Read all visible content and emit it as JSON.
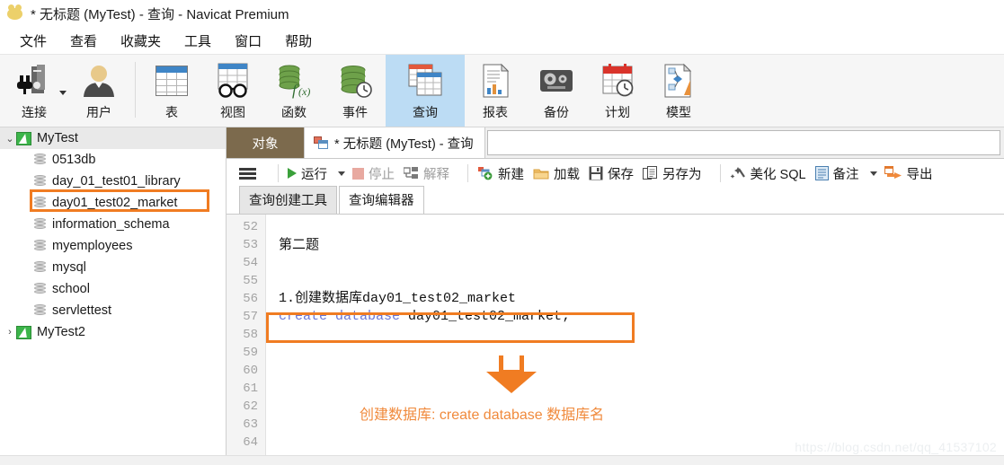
{
  "window": {
    "title": "* 无标题 (MyTest) - 查询 - Navicat Premium",
    "logo_icon": "navicat-logo-icon"
  },
  "menu": {
    "items": [
      {
        "label": "文件",
        "name": "menu-file"
      },
      {
        "label": "查看",
        "name": "menu-view"
      },
      {
        "label": "收藏夹",
        "name": "menu-favorites"
      },
      {
        "label": "工具",
        "name": "menu-tools"
      },
      {
        "label": "窗口",
        "name": "menu-window"
      },
      {
        "label": "帮助",
        "name": "menu-help"
      }
    ]
  },
  "ribbon": {
    "buttons": [
      {
        "label": "连接",
        "icon": "connection-icon",
        "active": false,
        "dropdown": true
      },
      {
        "label": "用户",
        "icon": "user-icon",
        "active": false,
        "dropdown": false
      },
      {
        "label": "表",
        "icon": "table-icon",
        "active": false,
        "dropdown": false
      },
      {
        "label": "视图",
        "icon": "view-icon",
        "active": false,
        "dropdown": false
      },
      {
        "label": "函数",
        "icon": "function-icon",
        "active": false,
        "dropdown": false
      },
      {
        "label": "事件",
        "icon": "event-icon",
        "active": false,
        "dropdown": false
      },
      {
        "label": "查询",
        "icon": "query-icon",
        "active": true,
        "dropdown": false
      },
      {
        "label": "报表",
        "icon": "report-icon",
        "active": false,
        "dropdown": false
      },
      {
        "label": "备份",
        "icon": "backup-icon",
        "active": false,
        "dropdown": false
      },
      {
        "label": "计划",
        "icon": "schedule-icon",
        "active": false,
        "dropdown": false
      },
      {
        "label": "模型",
        "icon": "model-icon",
        "active": false,
        "dropdown": false
      }
    ]
  },
  "sidebar": {
    "connections": [
      {
        "label": "MyTest",
        "expanded": true,
        "twisty": "⌄",
        "selected": true,
        "databases": [
          "0513db",
          "day_01_test01_library",
          "day01_test02_market",
          "information_schema",
          "myemployees",
          "mysql",
          "school",
          "servlettest"
        ],
        "highlighted_database": "day01_test02_market"
      },
      {
        "label": "MyTest2",
        "expanded": false,
        "twisty": "›",
        "selected": false,
        "databases": []
      }
    ]
  },
  "tabs": {
    "object_tab": "对象",
    "query_tab": "* 无标题 (MyTest) - 查询",
    "query_tab_icon": "query-tab-icon"
  },
  "query_toolbar": {
    "menu_icon": "hamburger-menu-icon",
    "items": [
      {
        "label": "运行",
        "icon": "play-icon",
        "disabled": false,
        "dropdown": true
      },
      {
        "label": "停止",
        "icon": "stop-icon",
        "disabled": true,
        "dropdown": false
      },
      {
        "label": "解释",
        "icon": "explain-icon",
        "disabled": true,
        "dropdown": false
      },
      {
        "label": "新建",
        "icon": "new-icon",
        "disabled": false,
        "dropdown": false
      },
      {
        "label": "加载",
        "icon": "load-icon",
        "disabled": false,
        "dropdown": false
      },
      {
        "label": "保存",
        "icon": "save-icon",
        "disabled": false,
        "dropdown": false
      },
      {
        "label": "另存为",
        "icon": "save-as-icon",
        "disabled": false,
        "dropdown": false
      },
      {
        "label": "美化 SQL",
        "icon": "beautify-icon",
        "disabled": false,
        "dropdown": false
      },
      {
        "label": "备注",
        "icon": "note-icon",
        "disabled": false,
        "dropdown": true
      },
      {
        "label": "导出",
        "icon": "export-icon",
        "disabled": false,
        "dropdown": false
      }
    ]
  },
  "sub_tabs": {
    "items": [
      {
        "label": "查询创建工具",
        "active": false
      },
      {
        "label": "查询编辑器",
        "active": true
      }
    ]
  },
  "editor": {
    "line_numbers": [
      "52",
      "53",
      "54",
      "55",
      "56",
      "57",
      "58",
      "59",
      "60",
      "61",
      "62",
      "63",
      "64"
    ],
    "lines": [
      {
        "num": "52",
        "text": "",
        "type": "plain"
      },
      {
        "num": "53",
        "text": "第二题",
        "type": "cn"
      },
      {
        "num": "54",
        "text": "",
        "type": "plain"
      },
      {
        "num": "55",
        "text": "",
        "type": "plain"
      },
      {
        "num": "56",
        "text": "1.创建数据库day01_test02_market",
        "type": "comment"
      },
      {
        "num": "57",
        "keyword": "create database",
        "rest": " day01_test02_market;",
        "type": "sql",
        "highlighted": true
      },
      {
        "num": "58",
        "text": "",
        "type": "plain"
      },
      {
        "num": "59",
        "text": "",
        "type": "plain"
      },
      {
        "num": "60",
        "text": "",
        "type": "plain"
      },
      {
        "num": "61",
        "text": "",
        "type": "plain"
      },
      {
        "num": "62",
        "text": "",
        "type": "plain"
      },
      {
        "num": "63",
        "text": "",
        "type": "plain"
      },
      {
        "num": "64",
        "text": "",
        "type": "plain"
      }
    ]
  },
  "annotations": {
    "accent_color": "#f07c22",
    "note_color": "#f08a3c",
    "arrow_icon": "down-arrow-annotation-icon",
    "note_text": "创建数据库: create  database  数据库名"
  },
  "watermark": {
    "text": "https://blog.csdn.net/qq_41537102"
  }
}
